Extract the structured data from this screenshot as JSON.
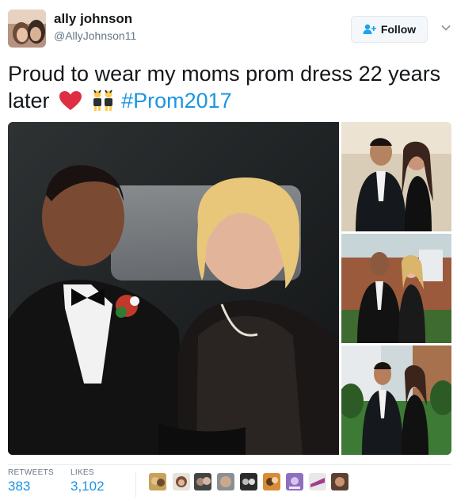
{
  "author": {
    "display_name": "ally johnson",
    "handle": "@AllyJohnson11",
    "avatar_icon": "profile-photo"
  },
  "follow_button": {
    "label": "Follow",
    "icon": "add-person-icon"
  },
  "more_icon": "chevron-down-icon",
  "tweet": {
    "text_main": "Proud to wear my moms prom dress 22 years later",
    "emoji_heart": "red-heart",
    "emoji_dancers": "dancers",
    "hashtag": "#Prom2017"
  },
  "media": {
    "main_photo": "prom-couple-1995",
    "thumbs": [
      "prom-couple-indoor",
      "prom-couple-outdoor-brick",
      "prom-couple-outdoor-lawn"
    ]
  },
  "stats": {
    "retweets_label": "RETWEETS",
    "retweets_value": "383",
    "likes_label": "LIKES",
    "likes_value": "3,102"
  },
  "likers": [
    "liker-1",
    "liker-2",
    "liker-3",
    "liker-4",
    "liker-5",
    "liker-6",
    "liker-7",
    "liker-8",
    "liker-9"
  ],
  "colors": {
    "link_blue": "#1b95e0",
    "heart_red": "#dd2e44",
    "muted_gray": "#657786"
  }
}
